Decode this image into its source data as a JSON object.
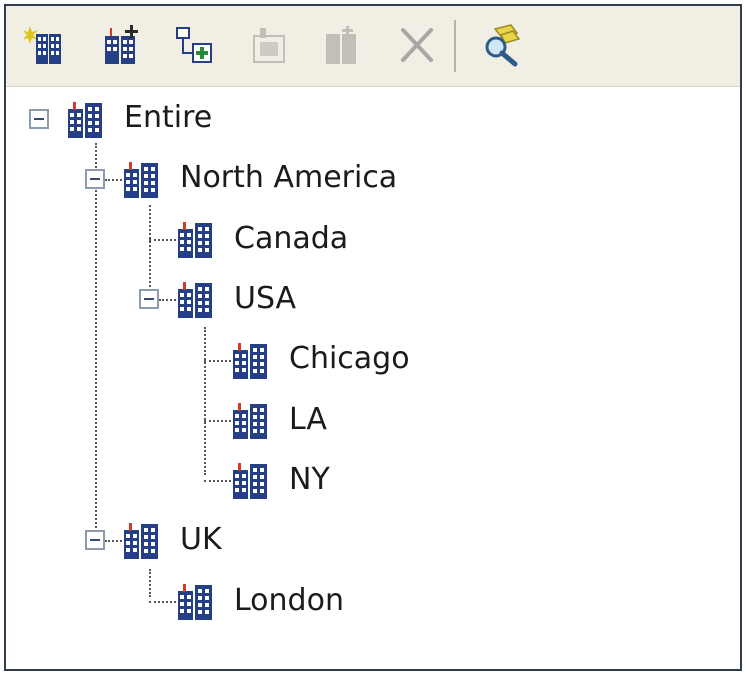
{
  "toolbar": {
    "buttons": [
      {
        "icon": "new-building-icon",
        "enabled": true
      },
      {
        "icon": "add-child-building-icon",
        "enabled": true
      },
      {
        "icon": "add-sibling-icon",
        "enabled": true
      },
      {
        "icon": "move-building-icon",
        "enabled": false
      },
      {
        "icon": "building-properties-icon",
        "enabled": false
      },
      {
        "icon": "delete-icon",
        "enabled": false
      },
      {
        "icon": "search-icon",
        "enabled": true
      }
    ]
  },
  "tree": {
    "nodes": [
      {
        "label": "Entire",
        "icon": "building-icon",
        "expanded": true
      },
      {
        "label": "North America",
        "icon": "building-icon",
        "expanded": true
      },
      {
        "label": "Canada",
        "icon": "building-icon"
      },
      {
        "label": "USA",
        "icon": "building-icon",
        "expanded": true
      },
      {
        "label": "Chicago",
        "icon": "building-icon"
      },
      {
        "label": "LA",
        "icon": "building-icon"
      },
      {
        "label": "NY",
        "icon": "building-icon"
      },
      {
        "label": "UK",
        "icon": "building-icon",
        "expanded": true
      },
      {
        "label": "London",
        "icon": "building-icon"
      }
    ]
  },
  "colors": {
    "toolbar_bg": "#f1eee3",
    "frame_border": "#2f3d4f",
    "icon_blue": "#243f86",
    "icon_red": "#d23a2a"
  }
}
